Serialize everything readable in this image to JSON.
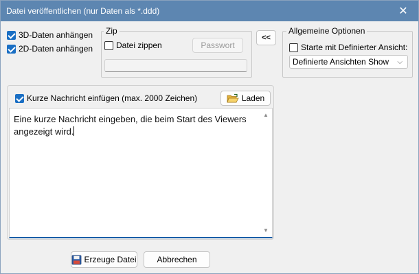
{
  "window": {
    "title": "Datei veröffentlichen (nur Daten als *.ddd)",
    "close_glyph": "✕"
  },
  "options": {
    "attach_3d": {
      "label": "3D-Daten anhängen",
      "checked": true
    },
    "attach_2d": {
      "label": "2D-Daten anhängen",
      "checked": true
    }
  },
  "zip": {
    "group_label": "Zip",
    "zip_file": {
      "label": "Datei zippen",
      "checked": false
    },
    "password_button": "Passwort",
    "password_value": ""
  },
  "collapse_button": "<<",
  "general": {
    "group_label": "Allgemeine Optionen",
    "start_with_view": {
      "label": "Starte mit Definierter Ansicht:",
      "checked": false
    },
    "view_select": "Definierte Ansichten Show",
    "chevron_glyph": "⌵"
  },
  "message": {
    "insert_short_message": {
      "label": "Kurze Nachricht einfügen (max. 2000 Zeichen)",
      "checked": true
    },
    "load_button": "Laden",
    "text": "Eine kurze Nachricht eingeben, die beim Start des Viewers angezeigt wird."
  },
  "footer": {
    "create_button": "Erzeuge Datei",
    "cancel_button": "Abbrechen"
  },
  "colors": {
    "titlebar": "#5d86b1",
    "accent": "#1a6fc4",
    "text_underline": "#1a5fa8"
  }
}
